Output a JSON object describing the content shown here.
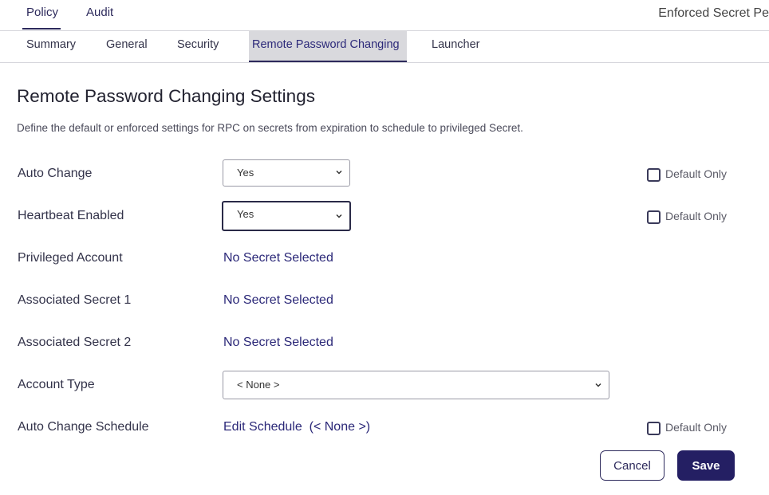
{
  "top_tabs": [
    {
      "label": "Policy"
    },
    {
      "label": "Audit"
    }
  ],
  "page_heading": "Enforced Secret Pe",
  "sub_tabs": [
    {
      "label": "Summary"
    },
    {
      "label": "General"
    },
    {
      "label": "Security"
    },
    {
      "label": "Remote Password Changing",
      "active": true
    },
    {
      "label": "Launcher"
    }
  ],
  "section": {
    "title": "Remote Password Changing Settings",
    "description": "Define the default or enforced settings for RPC on secrets from expiration to schedule to privileged Secret."
  },
  "rows": {
    "auto_change": {
      "label": "Auto Change",
      "value": "Yes",
      "default_only_label": "Default Only",
      "default_only_checked": false
    },
    "heartbeat": {
      "label": "Heartbeat Enabled",
      "value": "Yes",
      "default_only_label": "Default Only",
      "default_only_checked": false
    },
    "privileged_account": {
      "label": "Privileged Account",
      "link": "No Secret Selected"
    },
    "associated_secret_1": {
      "label": "Associated Secret 1",
      "link": "No Secret Selected"
    },
    "associated_secret_2": {
      "label": "Associated Secret 2",
      "link": "No Secret Selected"
    },
    "account_type": {
      "label": "Account Type",
      "value": "< None >"
    },
    "auto_change_schedule": {
      "label": "Auto Change Schedule",
      "link": "Edit Schedule  (< None >)",
      "default_only_label": "Default Only",
      "default_only_checked": false
    }
  },
  "buttons": {
    "cancel": "Cancel",
    "save": "Save"
  },
  "colors": {
    "accent": "#241f63",
    "active_tab_bg": "#d9d9dd",
    "link": "#2b2878"
  },
  "icons": {
    "select_arrow": "chevron-down-icon",
    "checkbox": "checkbox-icon"
  }
}
